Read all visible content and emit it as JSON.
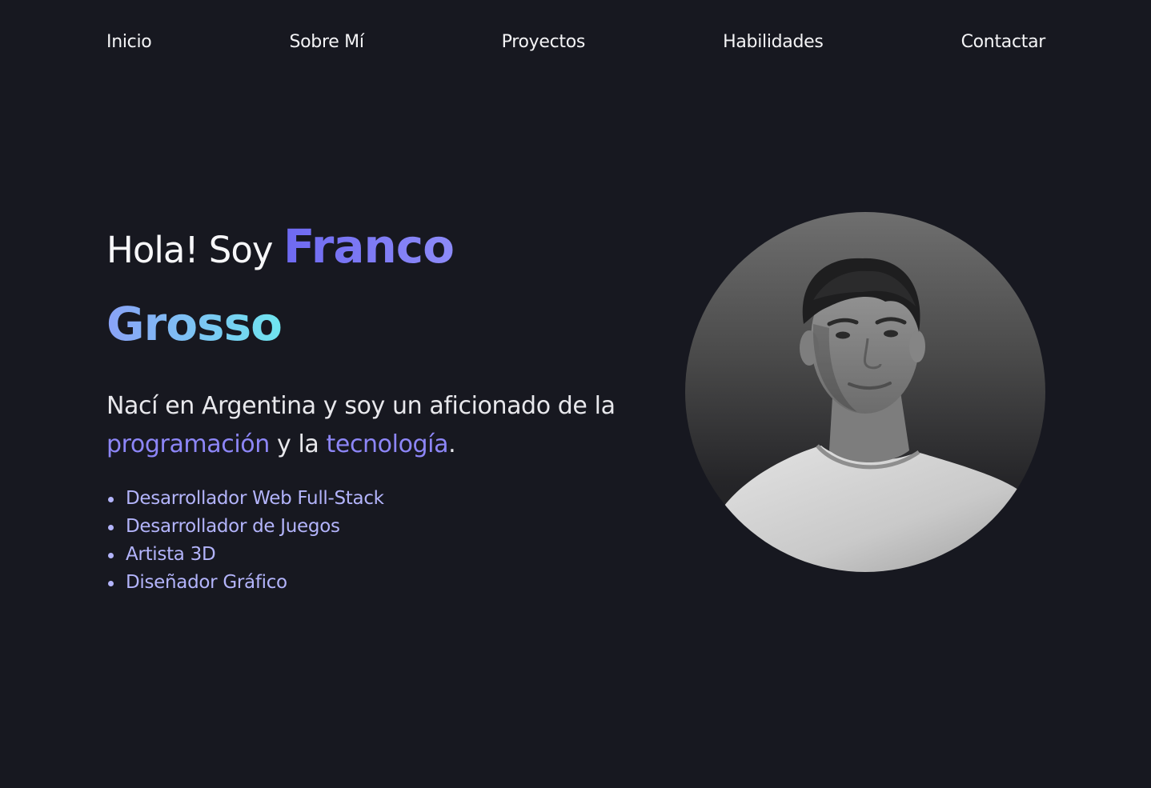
{
  "nav": {
    "items": [
      {
        "label": "Inicio"
      },
      {
        "label": "Sobre Mí"
      },
      {
        "label": "Proyectos"
      },
      {
        "label": "Habilidades"
      },
      {
        "label": "Contactar"
      }
    ]
  },
  "hero": {
    "greeting": "Hola! Soy",
    "first_name": "Franco",
    "last_name": "Grosso",
    "bio_part1": "Nací en Argentina y soy un aficionado de la",
    "bio_highlight1": "programación",
    "bio_part2": "y la",
    "bio_highlight2": "tecnología",
    "bio_end": ".",
    "roles": [
      "Desarrollador Web Full-Stack",
      "Desarrollador de Juegos",
      "Artista 3D",
      "Diseñador Gráfico"
    ]
  },
  "theme": {
    "background": "#171820",
    "accent_purple": "#7b6cf6",
    "accent_cyan": "#6fe0f2",
    "role_color": "#b3b4fb"
  }
}
